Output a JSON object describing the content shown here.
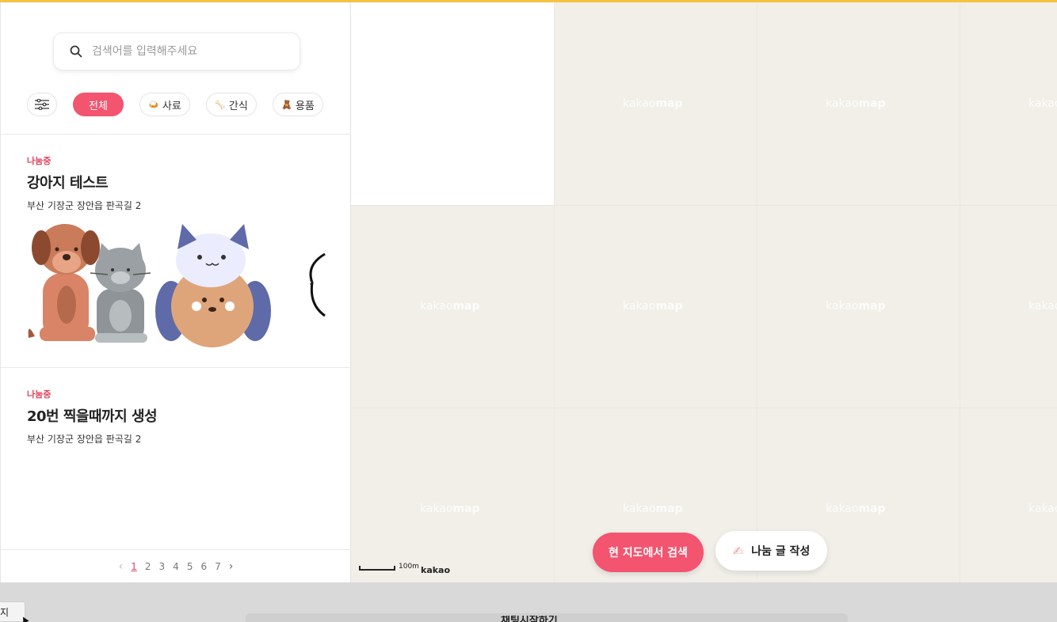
{
  "search": {
    "placeholder": "검색어를 입력해주세요"
  },
  "filters": {
    "active_label": "전체",
    "items": [
      {
        "emoji": "🍛",
        "label": "사료"
      },
      {
        "emoji": "🦴",
        "label": "간식"
      },
      {
        "emoji": "🧸",
        "label": "용품"
      }
    ]
  },
  "posts": [
    {
      "status": "나눔중",
      "title": "강아지 테스트",
      "address": "부산 기장군 장안읍 판곡길 2"
    },
    {
      "status": "나눔중",
      "title": "20번 찍을때까지 생성",
      "address": "부산 기장군 장안읍 판곡길 2"
    }
  ],
  "pagination": {
    "pages": [
      "1",
      "2",
      "3",
      "4",
      "5",
      "6",
      "7"
    ],
    "current": "1",
    "prev": "‹",
    "next": "›"
  },
  "map": {
    "watermark_a": "kakao",
    "watermark_b": "map",
    "scale_label": "100m",
    "logo": "kakao",
    "search_here_label": "현 지도에서 검색",
    "write_label": "나눔 글 작성"
  },
  "bottom": {
    "tab_label": "지",
    "bar_text": "채팅시작하기"
  },
  "colors": {
    "accent": "#f3546f",
    "status": "#e0455f",
    "map_bg": "#f1efe8",
    "top_line": "#f5c242"
  }
}
